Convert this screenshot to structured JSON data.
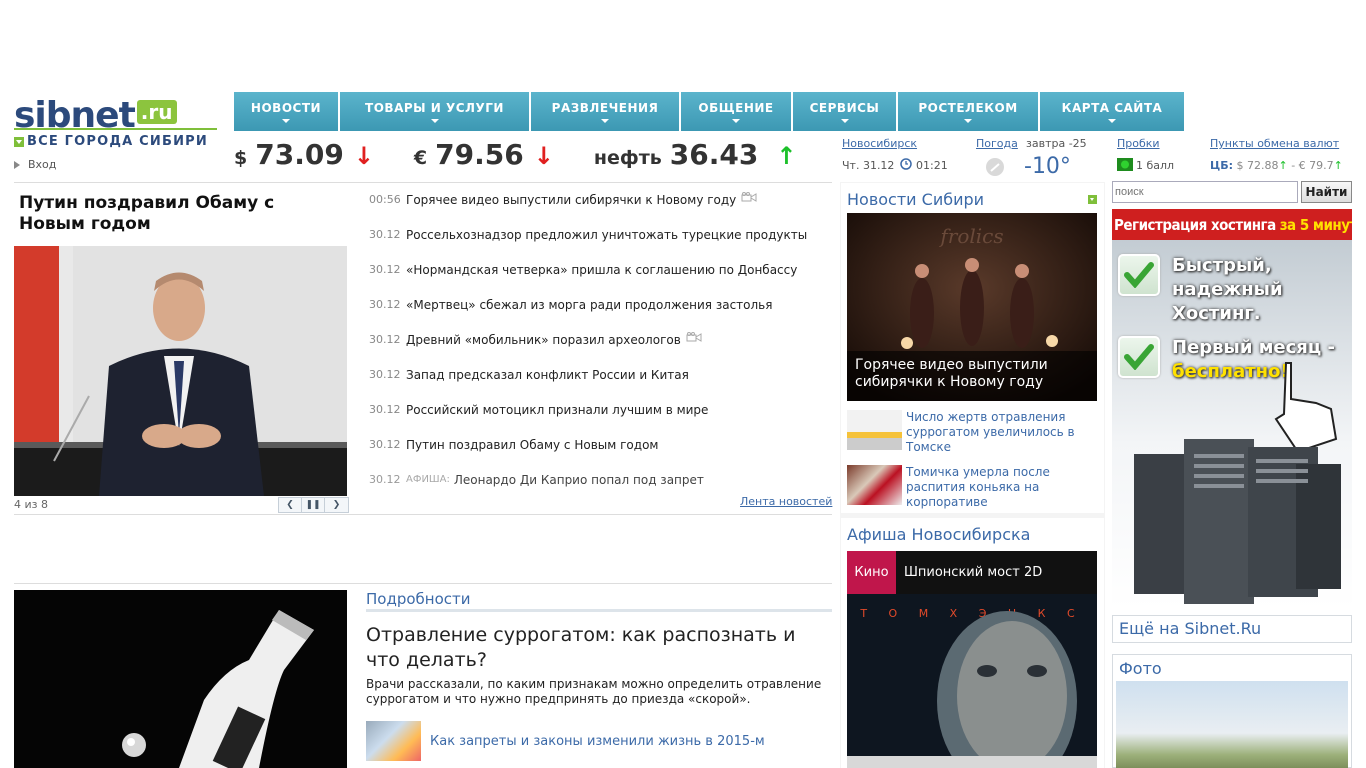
{
  "header": {
    "logo_text": "sibnet",
    "logo_ru": ".ru",
    "region_label": "ВСЕ ГОРОДА СИБИРИ",
    "login_label": "Вход"
  },
  "nav": [
    {
      "label": "НОВОСТИ"
    },
    {
      "label": "ТОВАРЫ И УСЛУГИ"
    },
    {
      "label": "РАЗВЛЕЧЕНИЯ"
    },
    {
      "label": "ОБЩЕНИЕ"
    },
    {
      "label": "СЕРВИСЫ"
    },
    {
      "label": "РОСТЕЛЕКОМ"
    },
    {
      "label": "КАРТА САЙТА"
    }
  ],
  "rates": {
    "usd_symbol": "$",
    "usd_value": "73.09",
    "usd_trend": "↓",
    "eur_symbol": "€",
    "eur_value": "79.56",
    "eur_trend": "↓",
    "oil_label": "нефть",
    "oil_value": "36.43",
    "oil_trend": "↑"
  },
  "info": {
    "city": "Новосибирск",
    "date": "Чт. 31.12",
    "time": "01:21",
    "weather_link": "Погода",
    "weather_tomorrow": "завтра -25",
    "temperature": "-10°",
    "traffic_link": "Пробки",
    "traffic_value": "1 балл",
    "exchange_link": "Пункты обмена валют",
    "cb_label": "ЦБ:",
    "cb_usd": "$ 72.88",
    "cb_eur": "- € 79.7"
  },
  "slider": {
    "title": "Путин поздравил Обаму с Новым годом",
    "counter": "4 из 8"
  },
  "news": [
    {
      "time": "00:56",
      "tag": "",
      "title": "Горячее видео выпустили сибирячки к Новому году",
      "video": true
    },
    {
      "time": "30.12",
      "tag": "",
      "title": "Россельхознадзор предложил уничтожать турецкие продукты",
      "video": false
    },
    {
      "time": "30.12",
      "tag": "",
      "title": "«Нормандская четверка» пришла к соглашению по Донбассу",
      "video": false
    },
    {
      "time": "30.12",
      "tag": "",
      "title": "«Мертвец» сбежал из морга ради продолжения застолья",
      "video": false
    },
    {
      "time": "30.12",
      "tag": "",
      "title": "Древний «мобильник» поразил археологов",
      "video": true
    },
    {
      "time": "30.12",
      "tag": "",
      "title": "Запад предсказал конфликт России и Китая",
      "video": false
    },
    {
      "time": "30.12",
      "tag": "",
      "title": "Российский мотоцикл признали лучшим в мире",
      "video": false
    },
    {
      "time": "30.12",
      "tag": "",
      "title": "Путин поздравил Обаму с Новым годом",
      "video": false
    },
    {
      "time": "30.12",
      "tag": "АФИША:",
      "title": "Леонардо Ди Каприо попал под запрет",
      "video": false
    }
  ],
  "news_more": "Лента новостей",
  "details": {
    "section": "Подробности",
    "title": "Отравление суррогатом: как распознать и что делать?",
    "lead": "Врачи рассказали, по каким признакам можно определить отравление суррогатом и что нужно предпринять до приезда «скорой».",
    "related": "Как запреты и законы изменили жизнь в 2015-м"
  },
  "siberia": {
    "title": "Новости Сибири",
    "main_caption": "Горячее видео выпустили сибирячки к Новому году",
    "items": [
      {
        "text": "Число жертв отравления суррогатом увеличилось в Томске"
      },
      {
        "text": "Томичка умерла после распития коньяка на корпоративе"
      }
    ]
  },
  "afisha": {
    "title": "Афиша Новосибирска",
    "tag": "Кино",
    "movie": "Шпионский мост 2D",
    "poster_credit": "Т О М   Х Э Н К С"
  },
  "search": {
    "placeholder": "поиск",
    "button": "Найти"
  },
  "ad": {
    "top_white": "Регистрация хостинга",
    "top_yellow": "за 5 минут",
    "line1": "Быстрый, надежный Хостинг.",
    "line2_a": "Первый месяц -",
    "line2_b": "бесплатно!"
  },
  "more_sibnet": "Ещё на Sibnet.Ru",
  "photo_title": "Фото",
  "colors": {
    "nav": "#4aa5bf",
    "link": "#3c6aa8",
    "brand": "#2c4a7c",
    "brand_green": "#7fbf3a",
    "down": "#e02020",
    "up": "#1cc02a"
  }
}
